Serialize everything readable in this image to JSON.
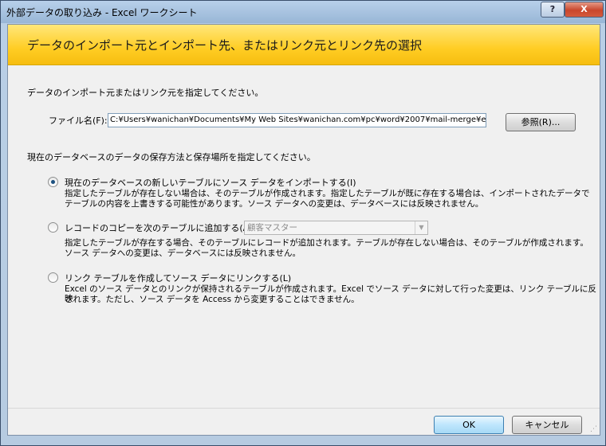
{
  "window": {
    "title": "外部データの取り込み - Excel ワークシート",
    "help_label": "?",
    "close_label": "X"
  },
  "banner": {
    "text": "データのインポート元とインポート先、またはリンク元とリンク先の選択"
  },
  "source": {
    "instruction": "データのインポート元またはリンク元を指定してください。",
    "file_label": "ファイル名(F):",
    "file_value": "C:¥Users¥wanichan¥Documents¥My Web Sites¥wanichan.com¥pc¥word¥2007¥mail-merge¥e",
    "browse_label": "参照(R)..."
  },
  "storage": {
    "instruction": "現在のデータベースのデータの保存方法と保存場所を指定してください。",
    "options": [
      {
        "label": "現在のデータベースの新しいテーブルにソース データをインポートする(I)",
        "selected": true,
        "desc_line1": "指定したテーブルが存在しない場合は、そのテーブルが作成されます。指定したテーブルが既に存在する場合は、インポートされたデータで",
        "desc_line2": "テーブルの内容を上書きする可能性があります。ソース データへの変更は、データベースには反映されません。"
      },
      {
        "label": "レコードのコピーを次のテーブルに追加する(A):",
        "selected": false,
        "combo_value": "顧客マスター",
        "desc_line1": "指定したテーブルが存在する場合、そのテーブルにレコードが追加されます。テーブルが存在しない場合は、そのテーブルが作成されます。",
        "desc_line2": "ソース データへの変更は、データベースには反映されません。"
      },
      {
        "label": "リンク テーブルを作成してソース データにリンクする(L)",
        "selected": false,
        "desc_line1": "Excel のソース データとのリンクが保持されるテーブルが作成されます。Excel でソース データに対して行った変更は、リンク テーブルに反映",
        "desc_line2": "されます。ただし、ソース データを Access から変更することはできません。"
      }
    ]
  },
  "footer": {
    "ok_label": "OK",
    "cancel_label": "キャンセル"
  }
}
